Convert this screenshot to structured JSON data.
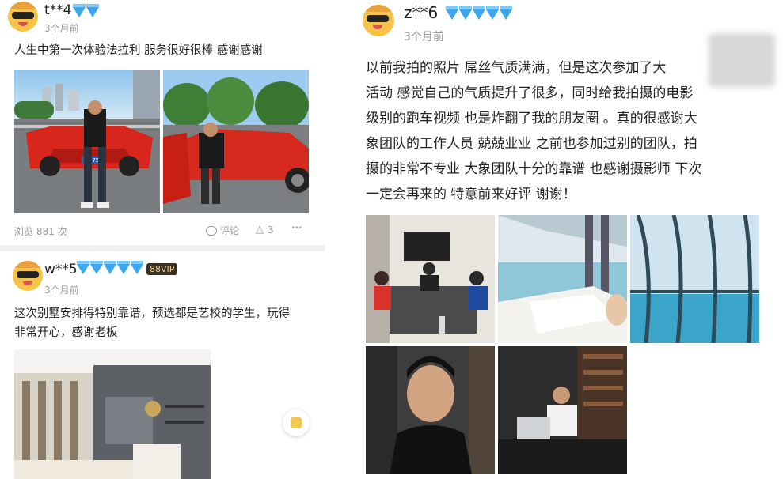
{
  "post1": {
    "username": "t**4",
    "time": "3个月前",
    "text": "人生中第一次体验法拉利  服务很好很棒 感谢感谢",
    "views": "浏览 881 次",
    "comment_label": "评论",
    "like_count": "3",
    "more_label": "···",
    "plate_text": "G675"
  },
  "post2": {
    "username": "w**5",
    "vip_label": "88VIP",
    "time": "3个月前",
    "text_line1": "这次别墅安排得特别靠谱，预选都是艺校的学生，玩得",
    "text_line2": "非常开心，感谢老板"
  },
  "post3": {
    "username": "z**6",
    "time": "3个月前",
    "lines": [
      "以前我拍的照片 屌丝气质满满，但是这次参加了大",
      "活动 感觉自己的气质提升了很多，同时给我拍摄的电影",
      "级别的跑车视频 也是炸翻了我的朋友圈 。真的很感谢大",
      "象团队的工作人员 兢兢业业 之前也参加过别的团队，拍",
      "摄的非常不专业 大象团队十分的靠谱 也感谢摄影师 下次",
      "一定会再来的 特意前来好评 谢谢！"
    ]
  },
  "colors": {
    "accent_gem": "#3da6ee",
    "avatar": "#f7c44a",
    "vip_bg": "#3b2f23"
  },
  "icons": [
    "avatar-icon",
    "diamond-icon",
    "comment-icon",
    "like-icon",
    "more-icon",
    "sticker-icon"
  ]
}
